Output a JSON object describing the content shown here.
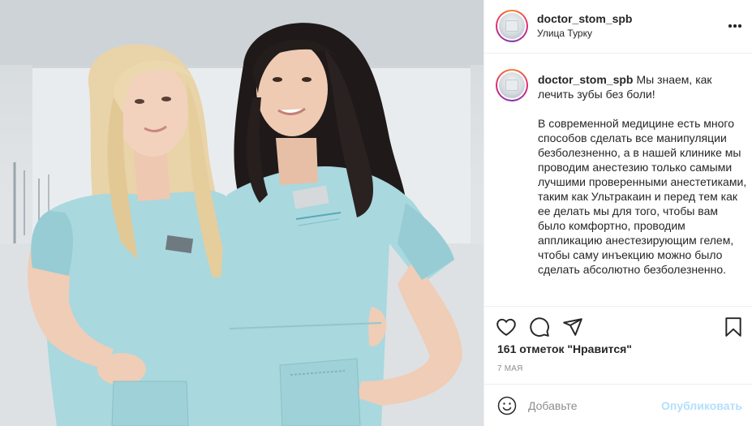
{
  "post": {
    "username": "doctor_stom_spb",
    "location": "Улица Турку",
    "caption_title": "Мы знаем, как лечить зубы без боли!",
    "caption_body": "В современной медицине есть много способов сделать все манипуляции безболезненно, а в нашей клинике мы проводим анестезию только самыми лучшими проверенными анестетиками, таким как Ультракаин и перед тем как ее делать мы для того, чтобы вам было комфортно, проводим аппликацию анестезирующим гелем, чтобы саму инъекцию можно было сделать абсолютно безболезненно.",
    "likes": "161 отметок \"Нравится\"",
    "date": "7 мая"
  },
  "comment": {
    "placeholder": "Добавьте",
    "publish_label": "Опубликовать"
  },
  "icons": {
    "more": "more-horizontal-icon",
    "like": "heart-icon",
    "comment": "comment-bubble-icon",
    "share": "paper-plane-icon",
    "save": "bookmark-icon",
    "emoji": "smiley-icon"
  },
  "colors": {
    "text": "#262626",
    "muted": "#8e8e8e",
    "publish_disabled": "#b2dffc",
    "scrubs": "#a9d8df"
  }
}
